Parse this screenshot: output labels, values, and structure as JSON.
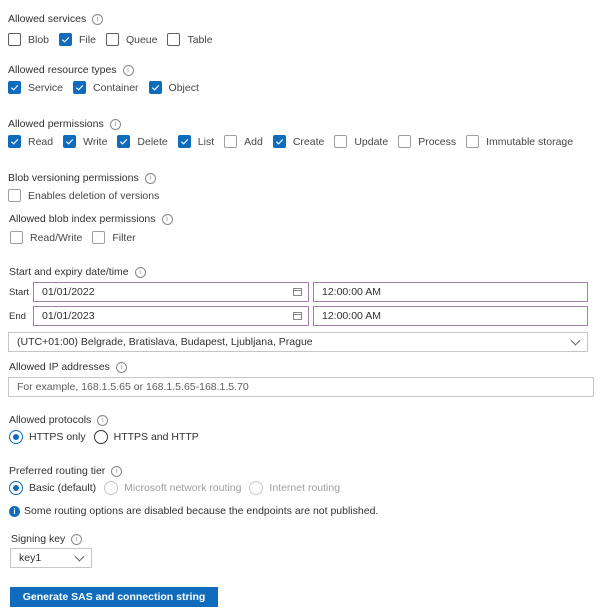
{
  "services": {
    "label": "Allowed services",
    "items": [
      {
        "label": "Blob",
        "checked": false
      },
      {
        "label": "File",
        "checked": true
      },
      {
        "label": "Queue",
        "checked": false
      },
      {
        "label": "Table",
        "checked": false
      }
    ]
  },
  "resource_types": {
    "label": "Allowed resource types",
    "items": [
      {
        "label": "Service",
        "checked": true
      },
      {
        "label": "Container",
        "checked": true
      },
      {
        "label": "Object",
        "checked": true
      }
    ]
  },
  "permissions": {
    "label": "Allowed permissions",
    "items": [
      {
        "label": "Read",
        "checked": true
      },
      {
        "label": "Write",
        "checked": true
      },
      {
        "label": "Delete",
        "checked": true
      },
      {
        "label": "List",
        "checked": true
      },
      {
        "label": "Add",
        "checked": false
      },
      {
        "label": "Create",
        "checked": true
      },
      {
        "label": "Update",
        "checked": false
      },
      {
        "label": "Process",
        "checked": false
      },
      {
        "label": "Immutable storage",
        "checked": false
      }
    ]
  },
  "versioning": {
    "label": "Blob versioning permissions",
    "items": [
      {
        "label": "Enables deletion of versions",
        "checked": false
      }
    ]
  },
  "blob_index": {
    "label": "Allowed blob index permissions",
    "items": [
      {
        "label": "Read/Write",
        "checked": false
      },
      {
        "label": "Filter",
        "checked": false
      }
    ]
  },
  "datetime": {
    "label": "Start and expiry date/time",
    "start_label": "Start",
    "start_date": "01/01/2022",
    "start_time": "12:00:00 AM",
    "end_label": "End",
    "end_date": "01/01/2023",
    "end_time": "12:00:00 AM",
    "timezone": "(UTC+01:00) Belgrade, Bratislava, Budapest, Ljubljana, Prague"
  },
  "ip": {
    "label": "Allowed IP addresses",
    "value": "",
    "placeholder": "For example, 168.1.5.65 or 168.1.5.65-168.1.5.70"
  },
  "protocols": {
    "label": "Allowed protocols",
    "options": [
      {
        "label": "HTTPS only",
        "selected": true
      },
      {
        "label": "HTTPS and HTTP",
        "selected": false
      }
    ]
  },
  "routing": {
    "label": "Preferred routing tier",
    "options": [
      {
        "label": "Basic (default)",
        "selected": true,
        "disabled": false
      },
      {
        "label": "Microsoft network routing",
        "selected": false,
        "disabled": true
      },
      {
        "label": "Internet routing",
        "selected": false,
        "disabled": true
      }
    ],
    "info": "Some routing options are disabled because the endpoints are not published."
  },
  "signing_key": {
    "label": "Signing key",
    "value": "key1"
  },
  "generate_button": "Generate SAS and connection string",
  "colors": {
    "accent": "#0f6cbd",
    "focus_border": "#a77fae"
  }
}
